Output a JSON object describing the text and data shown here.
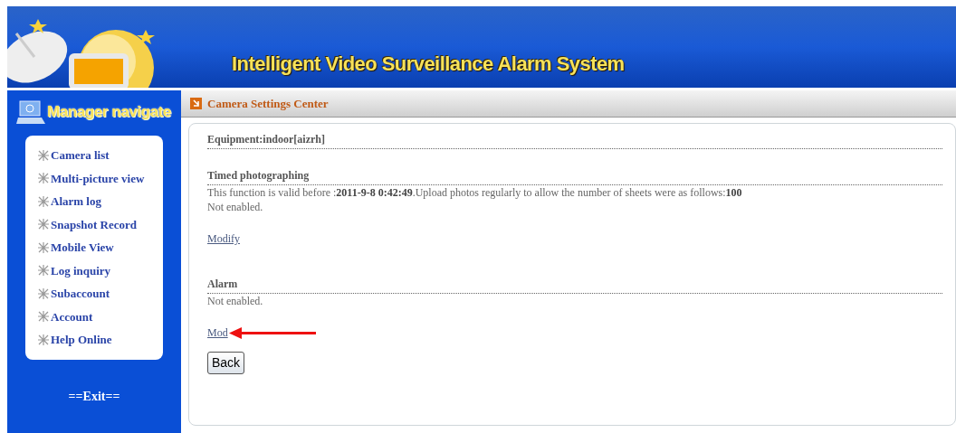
{
  "header": {
    "title": "Intelligent Video Surveillance Alarm System"
  },
  "sidebar": {
    "heading": "Manager navigate",
    "items": [
      {
        "label": "Camera list"
      },
      {
        "label": "Multi-picture view"
      },
      {
        "label": "Alarm log"
      },
      {
        "label": "Snapshot Record"
      },
      {
        "label": "Mobile View"
      },
      {
        "label": "Log inquiry"
      },
      {
        "label": "Subaccount"
      },
      {
        "label": "Account"
      },
      {
        "label": "Help Online"
      }
    ],
    "exit": "==Exit=="
  },
  "panel": {
    "title": "Camera Settings Center",
    "sections": [
      {
        "heading": "Equipment:indoor[aizrh]"
      },
      {
        "heading": "Timed photographing",
        "lines": [
          "This function is valid before :**2011-9-8 0:42:49**.Upload photos regularly to allow the number of sheets were as follows:**100**",
          "Not enabled."
        ],
        "link": "Modify"
      },
      {
        "heading": "Alarm",
        "lines": [
          "Not enabled."
        ],
        "link": "Mod",
        "annotated": true
      }
    ],
    "button": "Back"
  }
}
